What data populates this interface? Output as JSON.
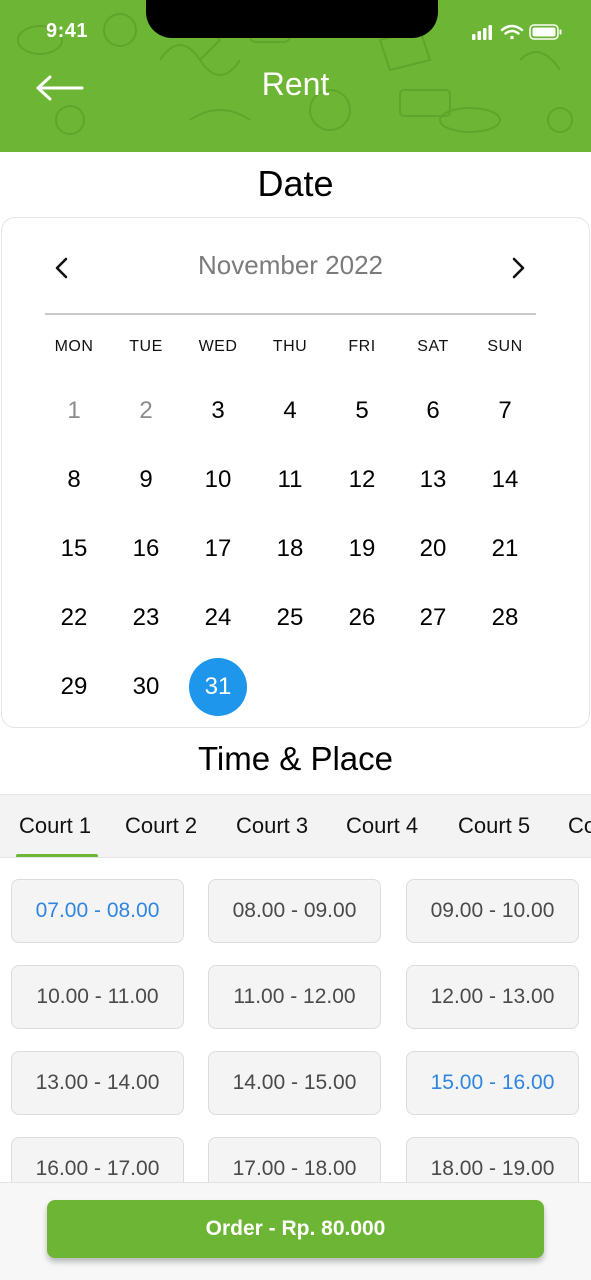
{
  "status_bar": {
    "time": "9:41",
    "icons": [
      "signal-icon",
      "wifi-icon",
      "battery-icon"
    ]
  },
  "header": {
    "title": "Rent",
    "back_icon": "arrow-left-icon",
    "background": "#6db534"
  },
  "date_section": {
    "title": "Date"
  },
  "calendar": {
    "month_label": "November 2022",
    "prev_icon": "chevron-left-icon",
    "next_icon": "chevron-right-icon",
    "weekdays": [
      "MON",
      "TUE",
      "WED",
      "THU",
      "FRI",
      "SAT",
      "SUN"
    ],
    "days": [
      {
        "label": "1",
        "muted": true
      },
      {
        "label": "2",
        "muted": true
      },
      {
        "label": "3"
      },
      {
        "label": "4"
      },
      {
        "label": "5"
      },
      {
        "label": "6"
      },
      {
        "label": "7"
      },
      {
        "label": "8"
      },
      {
        "label": "9"
      },
      {
        "label": "10"
      },
      {
        "label": "11"
      },
      {
        "label": "12"
      },
      {
        "label": "13"
      },
      {
        "label": "14"
      },
      {
        "label": "15"
      },
      {
        "label": "16"
      },
      {
        "label": "17"
      },
      {
        "label": "18"
      },
      {
        "label": "19"
      },
      {
        "label": "20"
      },
      {
        "label": "21"
      },
      {
        "label": "22"
      },
      {
        "label": "23"
      },
      {
        "label": "24"
      },
      {
        "label": "25"
      },
      {
        "label": "26"
      },
      {
        "label": "27"
      },
      {
        "label": "28"
      },
      {
        "label": "29"
      },
      {
        "label": "30"
      },
      {
        "label": "31",
        "selected": true
      }
    ],
    "selected_color": "#1e96ec"
  },
  "time_section": {
    "title": "Time & Place"
  },
  "courts": {
    "tabs": [
      "Court 1",
      "Court 2",
      "Court 3",
      "Court 4",
      "Court 5",
      "Co"
    ],
    "active_index": 0
  },
  "slots": [
    {
      "label": "07.00 - 08.00",
      "active": true
    },
    {
      "label": "08.00 - 09.00"
    },
    {
      "label": "09.00 - 10.00"
    },
    {
      "label": "10.00 - 11.00"
    },
    {
      "label": "11.00 - 12.00"
    },
    {
      "label": "12.00 - 13.00"
    },
    {
      "label": "13.00 - 14.00"
    },
    {
      "label": "14.00 - 15.00"
    },
    {
      "label": "15.00 - 16.00",
      "active": true
    },
    {
      "label": "16.00 - 17.00"
    },
    {
      "label": "17.00 - 18.00"
    },
    {
      "label": "18.00 - 19.00"
    }
  ],
  "order": {
    "label": "Order - Rp. 80.000"
  },
  "colors": {
    "brand_green": "#6db534",
    "active_blue": "#2f86e0"
  }
}
